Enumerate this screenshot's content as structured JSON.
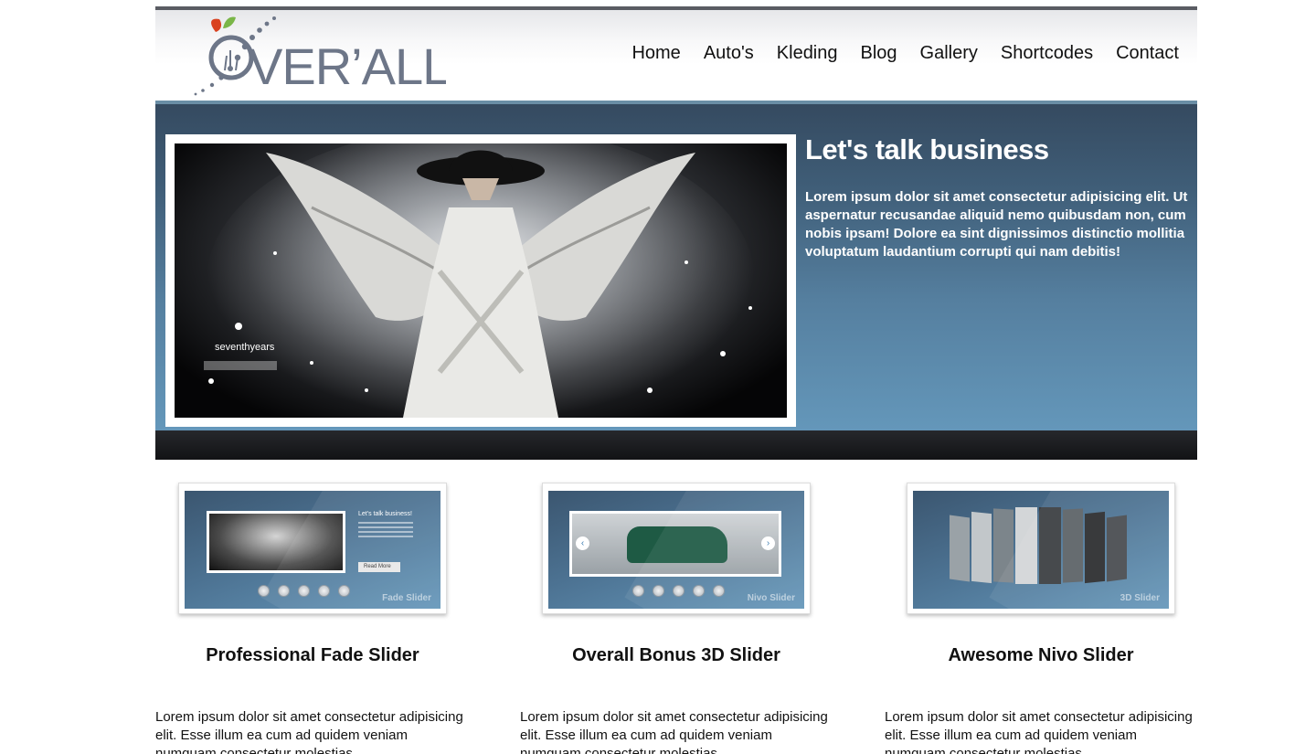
{
  "brand": {
    "logo_text": "OVER’ALL"
  },
  "nav": {
    "items": [
      {
        "id": "home",
        "label": "Home"
      },
      {
        "id": "autos",
        "label": "Auto's"
      },
      {
        "id": "kleding",
        "label": "Kleding"
      },
      {
        "id": "blog",
        "label": "Blog"
      },
      {
        "id": "gallery",
        "label": "Gallery"
      },
      {
        "id": "shortcodes",
        "label": "Shortcodes"
      },
      {
        "id": "contact",
        "label": "Contact"
      }
    ]
  },
  "hero": {
    "title": "Let's talk business",
    "body": "Lorem ipsum dolor sit amet consectetur adipisicing elit. Ut aspernatur recusandae aliquid nemo quibusdam non, cum nobis ipsam! Dolore ea sint dignissimos distinctio mollitia voluptatum laudantium corrupti qui nam debitis!",
    "image_watermark": "seventhyears"
  },
  "features": [
    {
      "thumb_label": "Fade Slider",
      "title": "Professional Fade Slider",
      "text": "Lorem ipsum dolor sit amet consectetur adipisicing elit. Esse illum ea cum ad quidem veniam numquam consectetur molestias"
    },
    {
      "thumb_label": "Nivo Slider",
      "title": "Overall Bonus 3D Slider",
      "text": "Lorem ipsum dolor sit amet consectetur adipisicing elit. Esse illum ea cum ad quidem veniam numquam consectetur molestias"
    },
    {
      "thumb_label": "3D Slider",
      "title": "Awesome Nivo Slider",
      "text": "Lorem ipsum dolor sit amet consectetur adipisicing elit. Esse illum ea cum ad quidem veniam numquam consectetur molestias"
    }
  ],
  "thumb_fade": {
    "mini_title": "Let's talk business!",
    "mini_button": "Read More"
  },
  "colors": {
    "hero_top": "#354a60",
    "hero_bottom": "#6497ba",
    "header_border": "#5a5c63",
    "logo_gray": "#6d7688",
    "logo_red": "#d9421f",
    "logo_green": "#7ab648"
  }
}
